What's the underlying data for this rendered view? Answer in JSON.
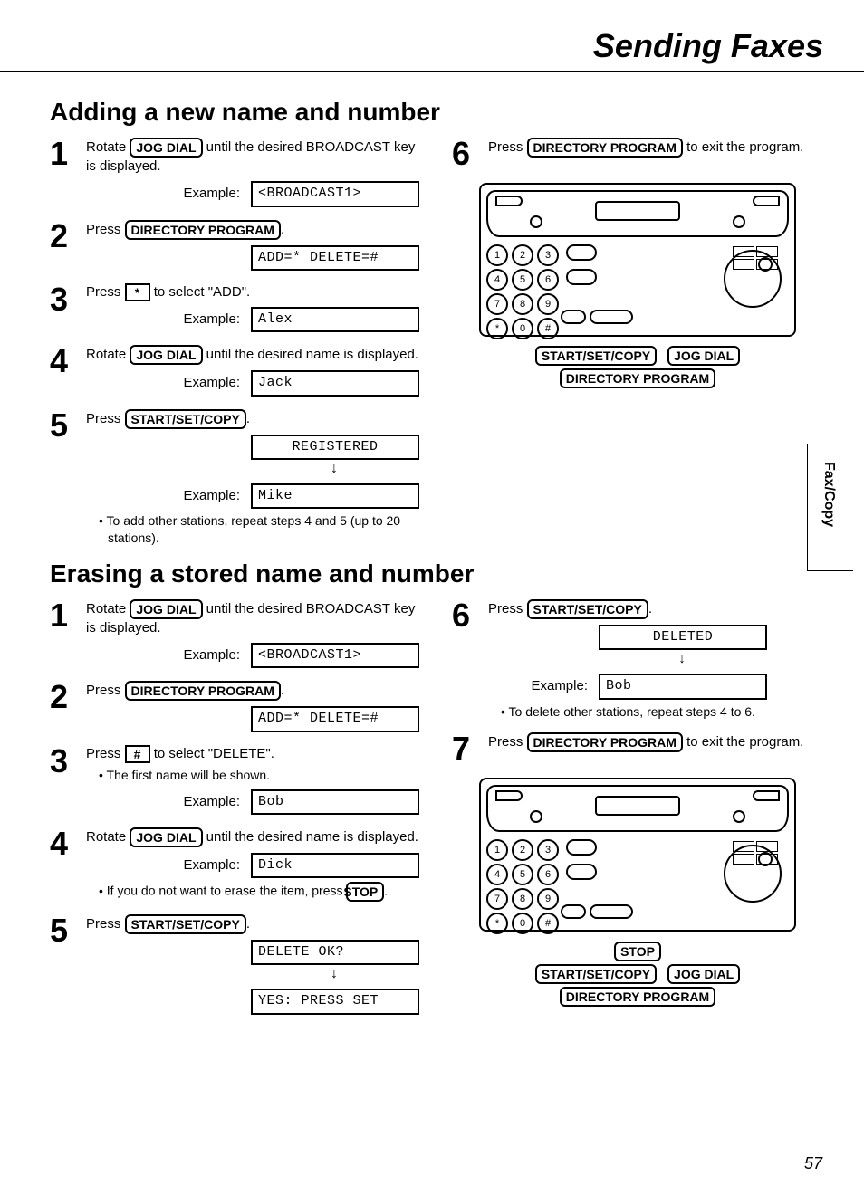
{
  "header": {
    "title": "Sending Faxes"
  },
  "side_tab": "Fax/Copy",
  "page_number": "57",
  "add": {
    "heading": "Adding a new name and number",
    "steps": [
      {
        "num": "1",
        "pre_text": "Rotate",
        "btn": "JOG DIAL",
        "post_text": "until the desired BROADCAST key is displayed.",
        "example_label": "Example:",
        "example_lcd": "<BROADCAST1>"
      },
      {
        "num": "2",
        "pre_text": "Press",
        "btn": "DIRECTORY PROGRAM",
        "post_text": ".",
        "example_lcd": "ADD=* DELETE=#"
      },
      {
        "num": "3",
        "pre_text": "Press",
        "keycap": "*",
        "post_text": "to select \"ADD\".",
        "example_label": "Example:",
        "example_lcd": "Alex"
      },
      {
        "num": "4",
        "pre_text": "Rotate",
        "btn": "JOG DIAL",
        "post_text": "until the desired name is displayed.",
        "example_label": "Example:",
        "example_lcd": "Jack"
      },
      {
        "num": "5",
        "pre_text": "Press",
        "btn": "START/SET/COPY",
        "post_text": ".",
        "lcd1": "REGISTERED",
        "arrow": "↓",
        "example_label": "Example:",
        "example_lcd": "Mike",
        "bullet": "To add other stations, repeat steps 4 and 5 (up to 20 stations)."
      },
      {
        "num": "6",
        "pre_text": "Press",
        "btn": "DIRECTORY PROGRAM",
        "post_text": "to exit the program."
      }
    ],
    "device_labels": {
      "a": "START/SET/COPY",
      "b": "JOG DIAL",
      "c": "DIRECTORY PROGRAM"
    }
  },
  "erase": {
    "heading": "Erasing a stored name and number",
    "steps_left": [
      {
        "num": "1",
        "pre_text": "Rotate",
        "btn": "JOG DIAL",
        "post_text": "until the desired BROADCAST key is displayed.",
        "example_label": "Example:",
        "example_lcd": "<BROADCAST1>"
      },
      {
        "num": "2",
        "pre_text": "Press",
        "btn": "DIRECTORY PROGRAM",
        "post_text": ".",
        "example_lcd": "ADD=* DELETE=#"
      },
      {
        "num": "3",
        "pre_text": "Press",
        "keycap": "#",
        "post_text": "to select \"DELETE\".",
        "bullet": "The first name will be shown.",
        "example_label": "Example:",
        "example_lcd": "Bob"
      },
      {
        "num": "4",
        "pre_text": "Rotate",
        "btn": "JOG DIAL",
        "post_text": "until the desired name is displayed.",
        "example_label": "Example:",
        "example_lcd": "Dick",
        "note_pre": "If you do not want to erase the item, press",
        "note_btn": "STOP",
        "note_post": "."
      },
      {
        "num": "5",
        "pre_text": "Press",
        "btn": "START/SET/COPY",
        "post_text": ".",
        "lcd1": "DELETE OK?",
        "arrow": "↓",
        "lcd2": "YES: PRESS SET"
      }
    ],
    "steps_right": [
      {
        "num": "6",
        "pre_text": "Press",
        "btn": "START/SET/COPY",
        "post_text": ".",
        "lcd1": "DELETED",
        "arrow": "↓",
        "example_label": "Example:",
        "example_lcd": "Bob",
        "bullet": "To delete other stations, repeat steps 4 to 6."
      },
      {
        "num": "7",
        "pre_text": "Press",
        "btn": "DIRECTORY PROGRAM",
        "post_text": "to exit the program."
      }
    ],
    "device_labels": {
      "stop": "STOP",
      "a": "START/SET/COPY",
      "b": "JOG DIAL",
      "c": "DIRECTORY PROGRAM"
    }
  },
  "keypad": {
    "rows": [
      [
        "1",
        "2",
        "3"
      ],
      [
        "4",
        "5",
        "6"
      ],
      [
        "7",
        "8",
        "9"
      ],
      [
        "*",
        "0",
        "#"
      ]
    ]
  }
}
